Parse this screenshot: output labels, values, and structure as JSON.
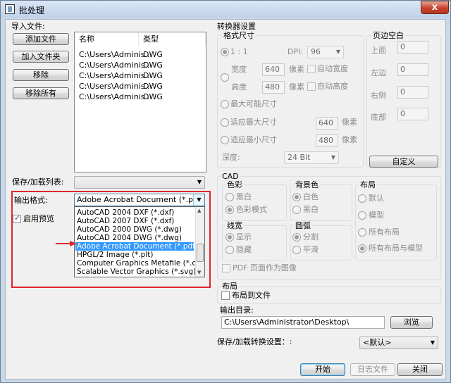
{
  "window": {
    "title": "批处理",
    "close_glyph": "x"
  },
  "import_group": {
    "label": "导入文件:",
    "buttons": {
      "add_file": "添加文件",
      "add_folder": "加入文件夹",
      "remove": "移除",
      "remove_all": "移除所有"
    },
    "file_list": {
      "columns": [
        "名称",
        "类型"
      ],
      "rows": [
        {
          "name": "C:\\Users\\Adminis...",
          "type": "DWG"
        },
        {
          "name": "C:\\Users\\Adminis...",
          "type": "DWG"
        },
        {
          "name": "C:\\Users\\Adminis...",
          "type": "DWG"
        },
        {
          "name": "C:\\Users\\Adminis...",
          "type": "DWG"
        },
        {
          "name": "C:\\Users\\Adminis...",
          "type": "DWG"
        }
      ]
    }
  },
  "save_load_list": {
    "label": "保存/加载列表:",
    "value": ""
  },
  "output_format": {
    "label": "输出格式:",
    "value": "Adobe Acrobat Document (*.pdf)",
    "options": [
      "AutoCAD 2004 DXF (*.dxf)",
      "AutoCAD 2007 DXF (*.dxf)",
      "AutoCAD 2000 DWG (*.dwg)",
      "AutoCAD 2004 DWG (*.dwg)",
      "Adobe Acrobat Document (*.pdf)",
      "HPGL/2 Image (*.plt)",
      "Computer Graphics Metafile (*.cgm)",
      "Scalable Vector Graphics (*.svg)"
    ],
    "selected_index": 4
  },
  "preview": {
    "label": "启用预览",
    "checked": true
  },
  "converter_settings": {
    "label": "转换器设置",
    "format_size": {
      "label": "格式尺寸",
      "ratio_label": "1 : 1",
      "dpi_label": "DPI:",
      "dpi_value": "96",
      "width_label": "宽度",
      "width_value": "640",
      "height_label": "高度",
      "height_value": "480",
      "px_unit": "像素",
      "auto_width": "自动宽度",
      "auto_height": "自动高度",
      "max_possible": "最大可能尺寸",
      "fit_max": "适应最大尺寸",
      "fit_min": "适应最小尺寸",
      "fit_max_value": "640",
      "fit_min_value": "480",
      "depth_label": "深度:",
      "depth_value": "24 Bit"
    },
    "margins": {
      "label": "页边空白",
      "top_label": "上面",
      "top_value": "0",
      "left_label": "左边",
      "left_value": "0",
      "right_label": "右侧",
      "right_value": "0",
      "bottom_label": "底部",
      "bottom_value": "0"
    },
    "custom_button": "自定义"
  },
  "cad": {
    "label": "CAD",
    "color": {
      "label": "色彩",
      "options": [
        "黑白",
        "色彩模式"
      ],
      "selected": 1
    },
    "background": {
      "label": "背景色",
      "options": [
        "白色",
        "黑白"
      ],
      "selected": 0
    },
    "layout": {
      "label": "布局",
      "options": [
        "默认",
        "模型",
        "所有布局",
        "所有布局与模型"
      ],
      "selected": 3
    },
    "lineweight": {
      "label": "线宽",
      "options": [
        "显示",
        "隐藏"
      ],
      "selected": 0
    },
    "arc": {
      "label": "圆弧",
      "options": [
        "分割",
        "平滑"
      ],
      "selected": 0
    },
    "pdf_as_image": "PDF 页面作为图像"
  },
  "layout_group": {
    "label": "布局",
    "layout_to_file": "布局到文件"
  },
  "output_dir": {
    "label": "输出目录:",
    "value": "C:\\Users\\Administrator\\Desktop\\",
    "browse": "浏览"
  },
  "convert_settings": {
    "label": "保存/加载转换设置：:",
    "value": "<默认>"
  },
  "footer": {
    "start": "开始",
    "log": "日志文件",
    "close": "关闭"
  },
  "colors": {
    "highlight": "#e0262e",
    "selection": "#3399ff",
    "title_bar": "#c9d7e8"
  }
}
